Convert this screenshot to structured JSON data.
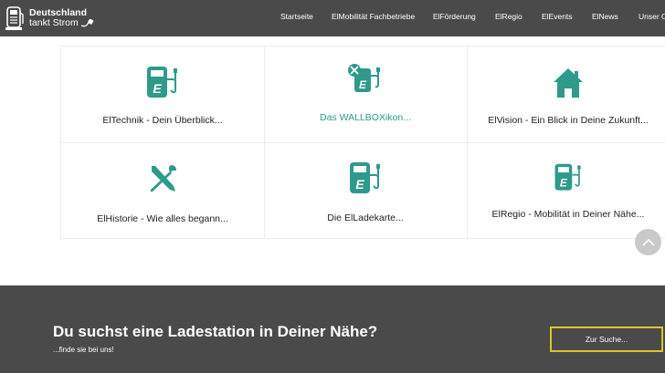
{
  "header": {
    "logo": {
      "line1": "Deutschland",
      "line2": "tankt Strom"
    },
    "nav": [
      {
        "label": "Startseite"
      },
      {
        "label": "ElMobilität Fachbetriebe"
      },
      {
        "label": "ElFörderung"
      },
      {
        "label": "ElRegio"
      },
      {
        "label": "ElEvents"
      },
      {
        "label": "ElNews"
      },
      {
        "label": "Unser O"
      }
    ]
  },
  "tiles": [
    {
      "label": "ElTechnik - Dein Überblick...",
      "icon": "charging-station-icon"
    },
    {
      "label": "Das WALLBOXikon...",
      "icon": "charging-station-tools-icon",
      "active": true
    },
    {
      "label": "ElVision - Ein Blick in Deine Zukunft...",
      "icon": "house-icon"
    },
    {
      "label": "ElHistorie - Wie alles begann...",
      "icon": "wrench-screwdriver-icon"
    },
    {
      "label": "Die ElLadekarte...",
      "icon": "charging-station-icon"
    },
    {
      "label": "ElRegio - Mobilität in Deiner Nähe...",
      "icon": "charging-station-icon"
    }
  ],
  "colors": {
    "accent": "#2e9a8a",
    "dark_bar": "#4a4a4a",
    "button_border": "#d8c72a"
  },
  "footer": {
    "heading": "Du suchst eine Ladestation in Deiner Nähe?",
    "subheading": "...finde sie bei uns!",
    "button_label": "Zur Suche..."
  }
}
